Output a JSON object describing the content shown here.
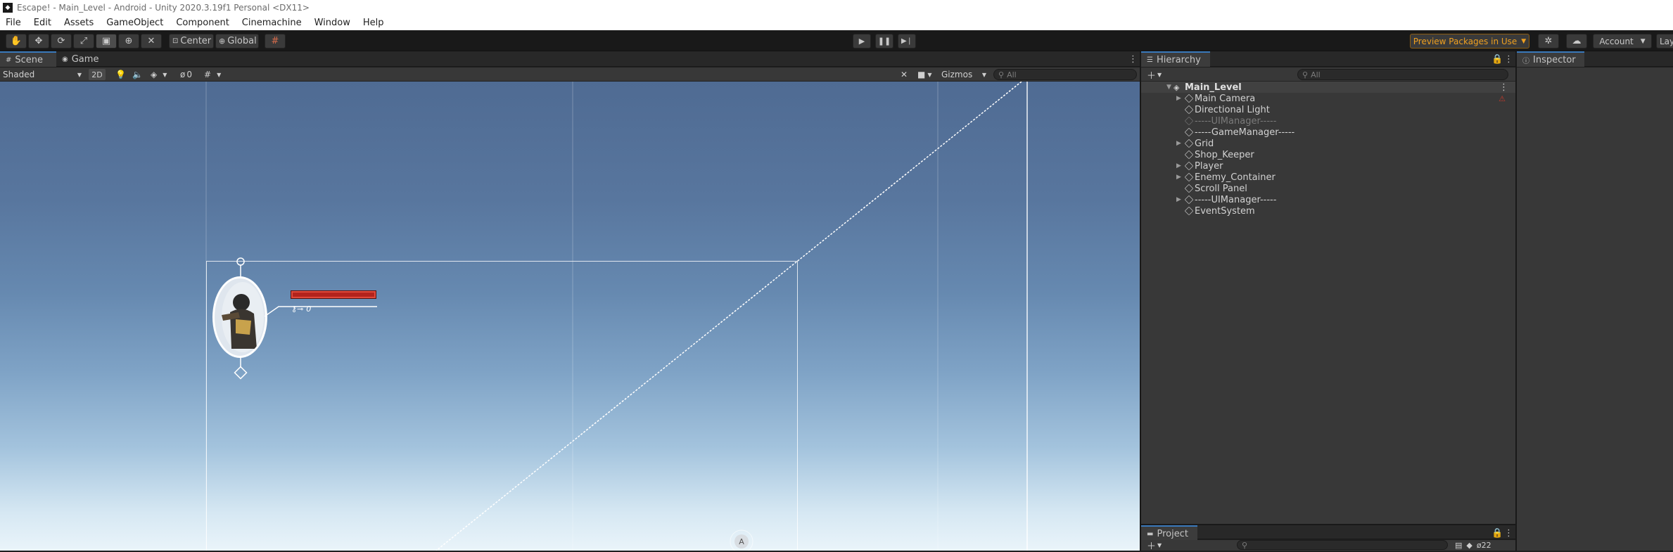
{
  "window": {
    "title": "Escape! - Main_Level - Android - Unity 2020.3.19f1 Personal <DX11>"
  },
  "menu": [
    "File",
    "Edit",
    "Assets",
    "GameObject",
    "Component",
    "Cinemachine",
    "Window",
    "Help"
  ],
  "toolbar": {
    "pivot_label": "Center",
    "space_label": "Global",
    "preview_packages_label": "Preview Packages in Use",
    "account_label": "Account",
    "layers_label": "Lay"
  },
  "scene": {
    "tabs": [
      "Scene",
      "Game"
    ],
    "shading_mode": "Shaded",
    "mode_2d": "2D",
    "hidden_count": "0",
    "gizmos_label": "Gizmos",
    "search_placeholder": "All"
  },
  "hierarchy": {
    "tab_label": "Hierarchy",
    "search_placeholder": "All",
    "scene_name": "Main_Level",
    "items": [
      {
        "label": "Main Camera",
        "expandable": true,
        "disabled": false
      },
      {
        "label": "Directional Light",
        "expandable": false,
        "disabled": false
      },
      {
        "label": "-----UIManager-----",
        "expandable": false,
        "disabled": true
      },
      {
        "label": "-----GameManager-----",
        "expandable": false,
        "disabled": false
      },
      {
        "label": "Grid",
        "expandable": true,
        "disabled": false
      },
      {
        "label": "Shop_Keeper",
        "expandable": false,
        "disabled": false
      },
      {
        "label": "Player",
        "expandable": true,
        "disabled": false
      },
      {
        "label": "Enemy_Container",
        "expandable": true,
        "disabled": false
      },
      {
        "label": "Scroll Panel",
        "expandable": false,
        "disabled": false
      },
      {
        "label": "-----UIManager-----",
        "expandable": true,
        "disabled": false
      },
      {
        "label": "EventSystem",
        "expandable": false,
        "disabled": false
      }
    ]
  },
  "inspector": {
    "tab_label": "Inspector"
  },
  "project": {
    "tab_label": "Project",
    "hidden_count": "22"
  },
  "hud": {
    "coin_count": "0"
  },
  "colors": {
    "accent": "#3a79bb",
    "preview_packages": "#f0a020",
    "health_bar": "#b3231c"
  }
}
